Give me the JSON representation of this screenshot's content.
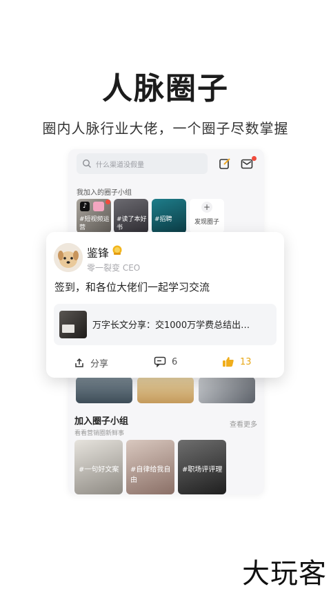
{
  "hero": {
    "title": "人脉圈子",
    "subtitle": "圈内人脉行业大佬，一个圈子尽数掌握"
  },
  "app": {
    "search": {
      "placeholder": "什么渠道没假量",
      "icon": "search-icon"
    },
    "top_icons": [
      "edit-icon",
      "message-icon"
    ],
    "my_circles_label": "我加入的圈子小组",
    "my_circles": [
      {
        "label": "#短视频运营",
        "icon": "tiktok-icon"
      },
      {
        "label": "#读了本好书"
      },
      {
        "label": "#招聘"
      }
    ],
    "discover_label": "发现圈子",
    "discover_plus": "+",
    "join_section": {
      "title": "加入圈子小组",
      "subtitle": "看看营销圈新鲜事",
      "more": "查看更多",
      "tiles": [
        {
          "label": "#一句好文案"
        },
        {
          "label": "#自律给我自由"
        },
        {
          "label": "#职场评评理"
        }
      ]
    }
  },
  "post_card": {
    "user_name": "鉴锋",
    "user_role": "零一裂变 CEO",
    "content": "签到，和各位大佬们一起学习交流",
    "shared_article": "万字长文分享：交1000万学费总结出…",
    "actions": {
      "share_label": "分享",
      "comment_count": "6",
      "like_count": "13"
    }
  },
  "brand": "大玩客",
  "colors": {
    "accent_red": "#f04b3c",
    "like_gold": "#e8a817",
    "page_bg": "#ffffff",
    "panel_bg": "#f6f6f8"
  }
}
